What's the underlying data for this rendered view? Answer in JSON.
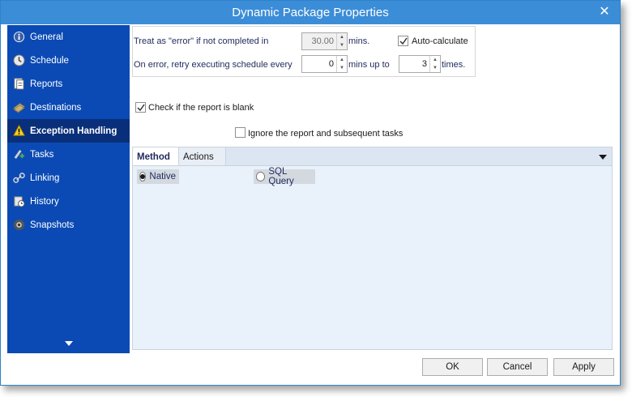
{
  "window": {
    "title": "Dynamic Package Properties"
  },
  "sidebar": {
    "items": [
      {
        "label": "General",
        "icon": "info-icon"
      },
      {
        "label": "Schedule",
        "icon": "clock-icon"
      },
      {
        "label": "Reports",
        "icon": "report-icon"
      },
      {
        "label": "Destinations",
        "icon": "destinations-icon"
      },
      {
        "label": "Exception Handling",
        "icon": "warning-icon",
        "active": true
      },
      {
        "label": "Tasks",
        "icon": "tasks-icon"
      },
      {
        "label": "Linking",
        "icon": "link-icon"
      },
      {
        "label": "History",
        "icon": "history-icon"
      },
      {
        "label": "Snapshots",
        "icon": "snapshots-icon"
      }
    ],
    "more_icon": "chevron-down-icon",
    "bg_color": "#0b4ab4",
    "active_color": "#0a2f7a"
  },
  "settings": {
    "error_label": "Treat as \"error\" if not completed in",
    "error_minutes": "30.00",
    "error_unit": "mins.",
    "autocalc_label": "Auto-calculate",
    "autocalc_checked": true,
    "retry_label": "On error, retry  executing schedule every",
    "retry_minutes": "0",
    "retry_unit": "mins up to",
    "retry_times": "3",
    "times_unit": "times."
  },
  "blank_check": {
    "label": "Check if the report is blank",
    "checked": true,
    "ignore_label": "Ignore the report and subsequent tasks",
    "ignore_checked": false
  },
  "tabs": {
    "method_label": "Method",
    "actions_label": "Actions",
    "active": "Method"
  },
  "method": {
    "native_label": "Native",
    "native_selected": true,
    "sql_label": "SQL Query",
    "sql_selected": false
  },
  "buttons": {
    "ok": "OK",
    "cancel": "Cancel",
    "apply": "Apply"
  },
  "colors": {
    "titlebar": "#3c8dd8",
    "accent": "#2f82c7"
  }
}
